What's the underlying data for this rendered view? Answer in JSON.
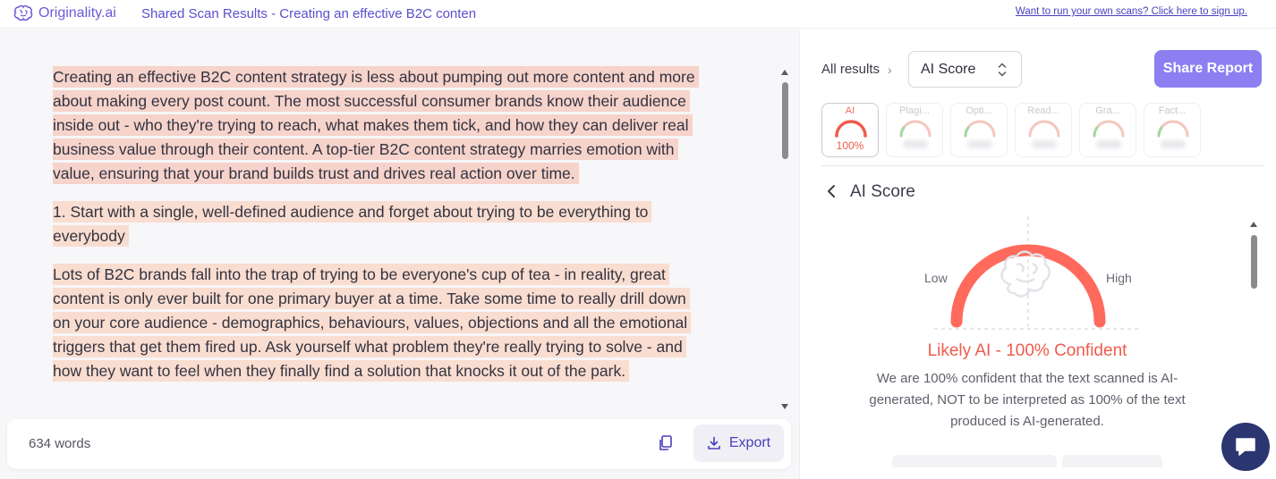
{
  "colors": {
    "brand": "#6a5bd8",
    "accent": "#8d7ef2",
    "ai_red": "#ef5b4c",
    "highlight": "#f6d3cb",
    "chat": "#2b3670"
  },
  "topbar": {
    "brand_name": "Originality.ai",
    "brand_icon": "brain-icon",
    "title": "Shared Scan Results - Creating an effective B2C conten",
    "signup_link": "Want to run your own scans? Click here to sign up."
  },
  "document": {
    "paragraphs": [
      "Creating an effective B2C content strategy is less about pumping out more content and more about making every post count. The most successful consumer brands know their audience inside out - who they're trying to reach, what makes them tick, and how they can deliver real business value through their content. A top-tier B2C content strategy marries emotion with value, ensuring that your brand builds trust and drives real action over time.",
      "1. Start with a single, well-defined audience and forget about trying to be everything to everybody",
      "Lots of B2C brands fall into the trap of trying to be everyone's cup of tea - in reality, great content is only ever built for one primary buyer at a time. Take some time to really drill down on your core audience - demographics, behaviours, values, objections and all the emotional triggers that get them fired up. Ask yourself what problem they're really trying to solve - and how they want to feel when they finally find a solution that knocks it out of the park."
    ],
    "word_count": "634 words",
    "copy_icon": "copy-icon",
    "export_label": "Export",
    "export_icon": "download-icon"
  },
  "results": {
    "all_results_label": "All results",
    "selected_score": "AI Score",
    "share_label": "Share Report",
    "tabs": [
      {
        "label": "AI",
        "value": "100%",
        "active": true
      },
      {
        "label": "Plagi...",
        "value": "",
        "active": false
      },
      {
        "label": "Opti...",
        "value": "",
        "active": false
      },
      {
        "label": "Read...",
        "value": "",
        "active": false
      },
      {
        "label": "Gra...",
        "value": "",
        "active": false
      },
      {
        "label": "Fact...",
        "value": "",
        "active": false
      }
    ],
    "section_title": "AI Score",
    "gauge": {
      "low_label": "Low",
      "high_label": "High",
      "ai_percent": 100
    },
    "verdict": "Likely AI - 100% Confident",
    "explanation": "We are 100% confident that the text scanned is AI-generated, NOT to be interpreted as 100% of the text produced is AI-generated."
  },
  "chat": {
    "icon": "chat-icon"
  }
}
